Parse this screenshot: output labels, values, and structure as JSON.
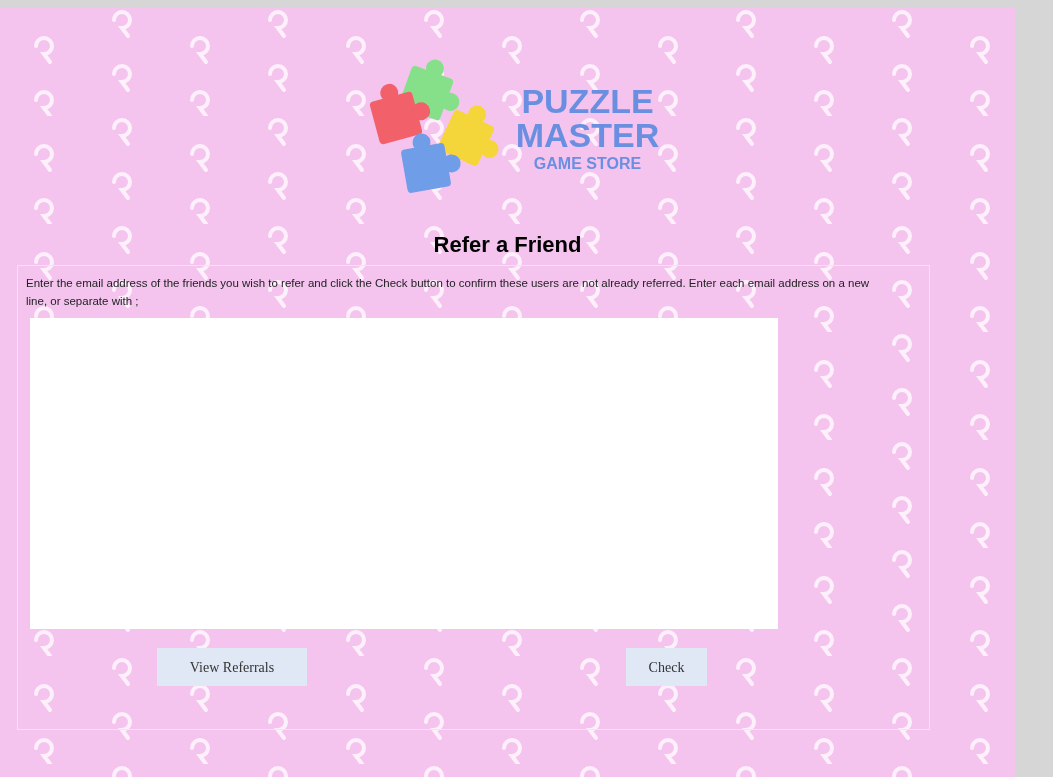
{
  "logo": {
    "lines": [
      "PUZZLE",
      "MASTER",
      "GAME STORE"
    ]
  },
  "heading": "Refer a Friend",
  "instructions": "Enter the email address of the friends you wish to refer and click the Check button to confirm these users are not already referred. Enter each email address on a new line, or separate with ;",
  "buttons": [
    {
      "kind": "view",
      "label": "View Referrals"
    },
    {
      "kind": "check",
      "label": "Check"
    }
  ]
}
